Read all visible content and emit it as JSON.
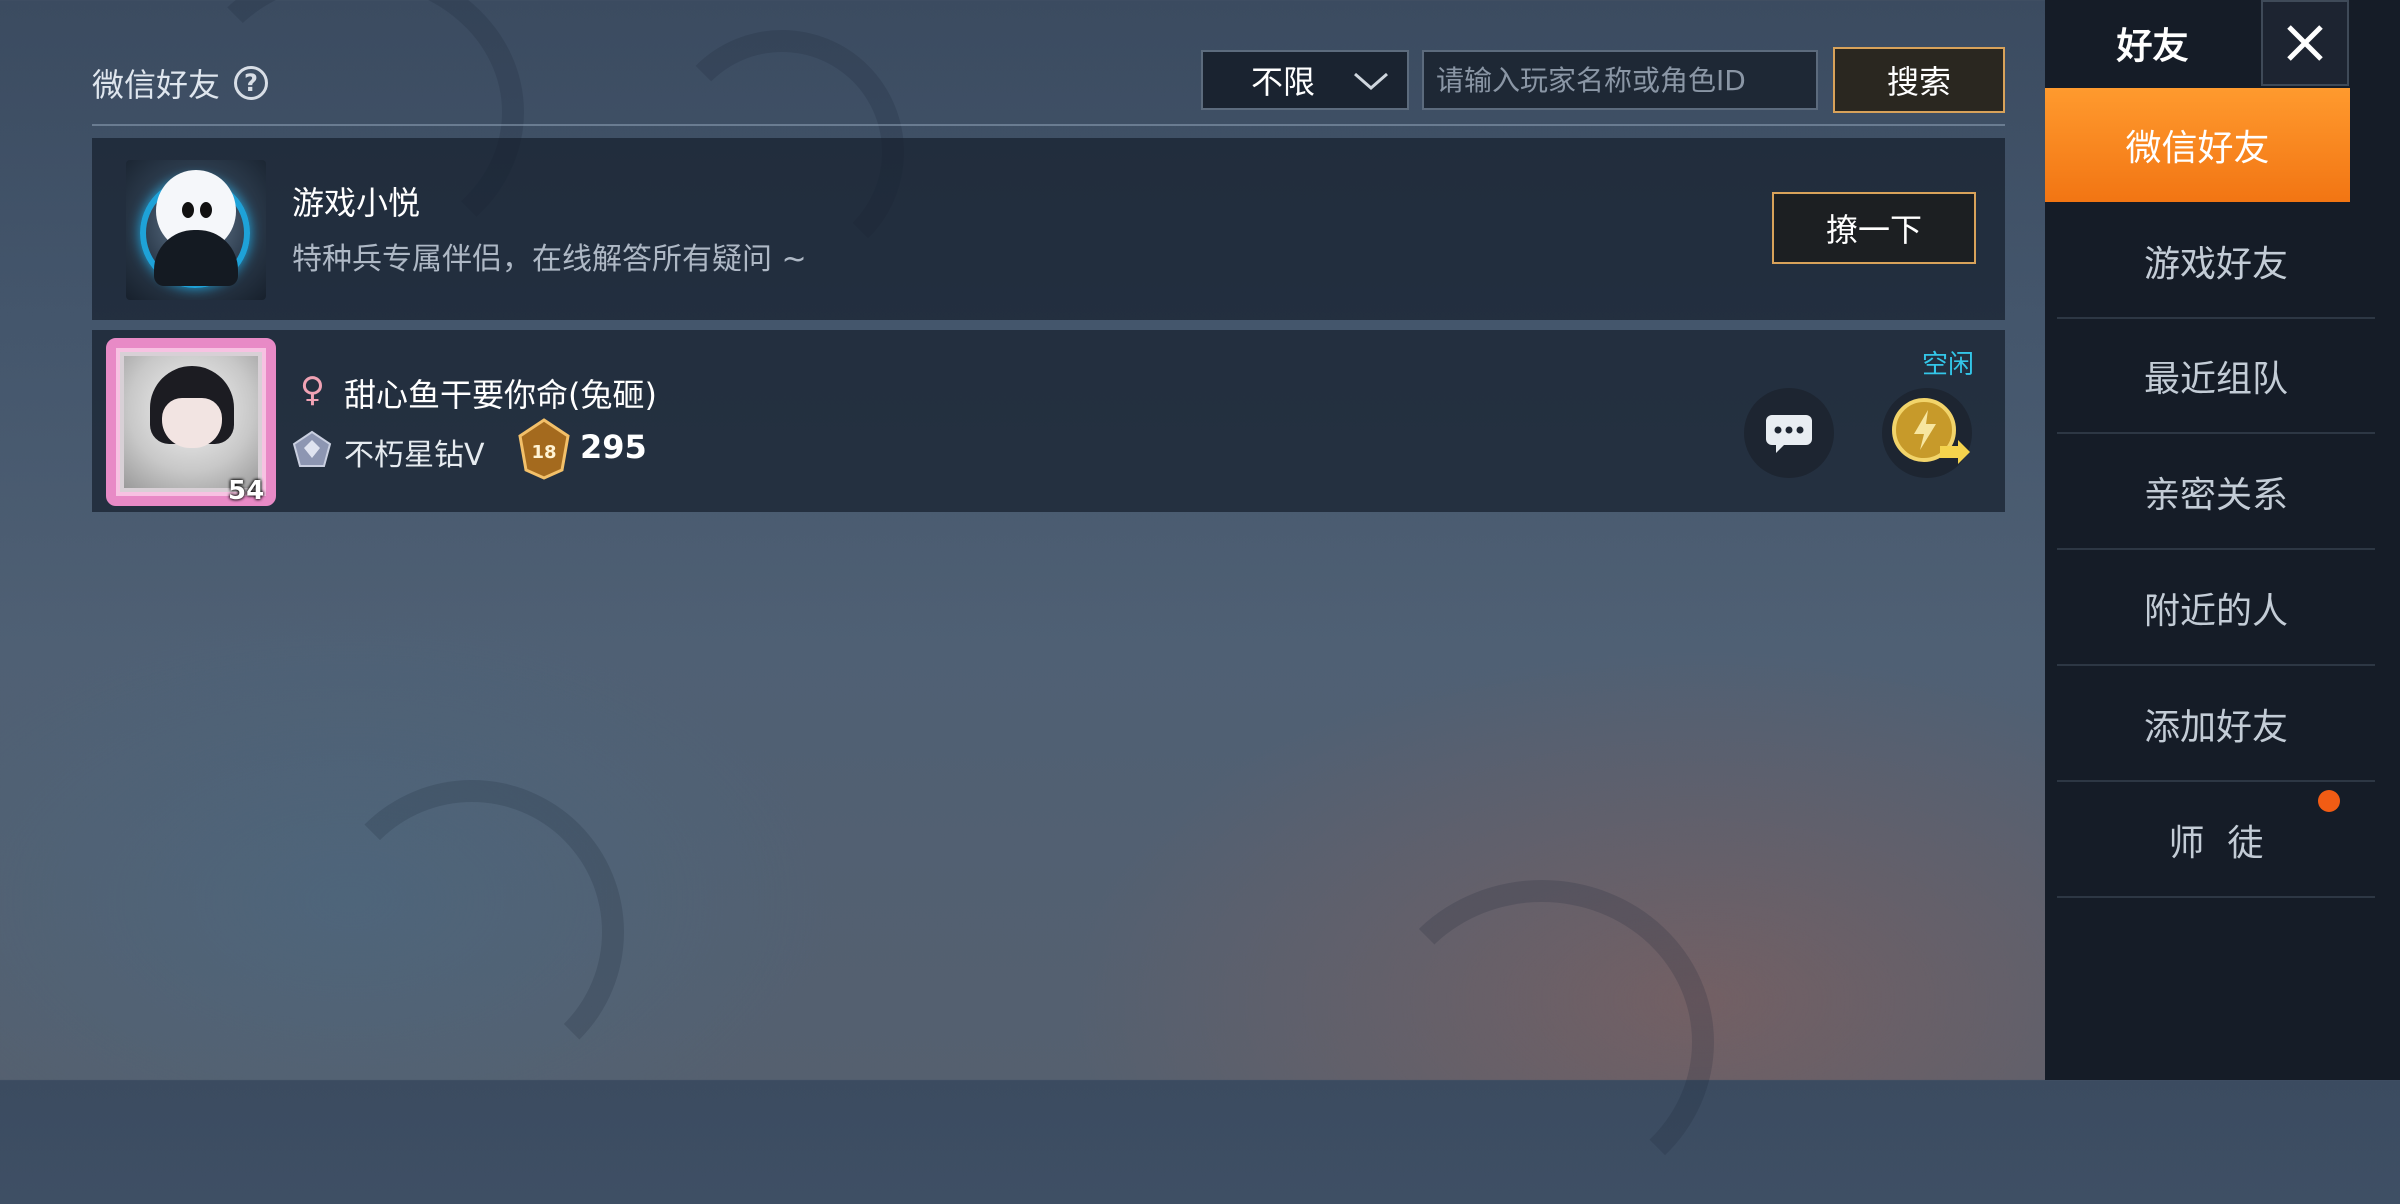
{
  "header": {
    "title": "微信好友",
    "filter_value": "不限",
    "search_placeholder": "请输入玩家名称或角色ID",
    "search_label": "搜索"
  },
  "bot": {
    "name": "游戏小悦",
    "description": "特种兵专属伴侣，在线解答所有疑问 ~",
    "poke_label": "撩一下"
  },
  "friends": [
    {
      "name": "甜心鱼干要你命(兔砸)",
      "level": "54",
      "rank": "不朽星钻Ⅴ",
      "tier_level": "18",
      "score": "295",
      "status": "空闲"
    }
  ],
  "sidebar": {
    "title": "好友",
    "items": [
      {
        "label": "微信好友",
        "active": true
      },
      {
        "label": "游戏好友"
      },
      {
        "label": "最近组队"
      },
      {
        "label": "亲密关系"
      },
      {
        "label": "附近的人"
      },
      {
        "label": "添加好友"
      },
      {
        "label": "师  徒",
        "has_badge": true
      }
    ]
  },
  "colors": {
    "accent_orange": "#f27513",
    "button_border_gold": "#d8a25a",
    "status_cyan": "#33c6e8",
    "badge_red": "#f25c14"
  },
  "icons": [
    "help-icon",
    "chevron-down-icon",
    "female-icon",
    "rank-icon",
    "tier-icon",
    "chat-icon",
    "invite-icon",
    "close-icon"
  ]
}
